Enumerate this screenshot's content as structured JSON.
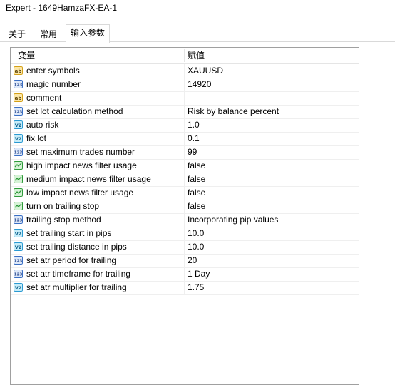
{
  "window": {
    "title": "Expert - 1649HamzaFX-EA-1"
  },
  "tabs": [
    {
      "label": "关于"
    },
    {
      "label": "常用"
    },
    {
      "label": "输入参数",
      "active": true
    }
  ],
  "table": {
    "headers": {
      "name": "变量",
      "value": "赋值"
    },
    "rows": [
      {
        "type": "ab",
        "name": "enter symbols",
        "value": "XAUUSD"
      },
      {
        "type": "123",
        "name": "magic number",
        "value": "14920"
      },
      {
        "type": "ab",
        "name": "comment",
        "value": ""
      },
      {
        "type": "123",
        "name": "set lot calculation method",
        "value": "Risk by balance percent"
      },
      {
        "type": "Va",
        "name": "auto risk",
        "value": "1.0"
      },
      {
        "type": "Va",
        "name": "fix lot",
        "value": "0.1"
      },
      {
        "type": "123",
        "name": "set maximum trades number",
        "value": "99"
      },
      {
        "type": "bool",
        "name": "high impact news filter usage",
        "value": "false"
      },
      {
        "type": "bool",
        "name": "medium impact news filter usage",
        "value": "false"
      },
      {
        "type": "bool",
        "name": "low impact news filter usage",
        "value": "false"
      },
      {
        "type": "bool",
        "name": "turn on trailing stop",
        "value": "false"
      },
      {
        "type": "123",
        "name": "trailing stop method",
        "value": "Incorporating pip values"
      },
      {
        "type": "Va",
        "name": "set trailing start in pips",
        "value": "10.0"
      },
      {
        "type": "Va",
        "name": "set trailing distance in pips",
        "value": "10.0"
      },
      {
        "type": "123",
        "name": "set atr period for trailing",
        "value": "20"
      },
      {
        "type": "123",
        "name": "set atr timeframe for trailing",
        "value": "1 Day"
      },
      {
        "type": "Va",
        "name": "set atr multiplier for trailing",
        "value": "1.75"
      }
    ]
  },
  "icon_names": {
    "ab": "string-type-icon",
    "123": "integer-type-icon",
    "Va": "double-type-icon",
    "bool": "bool-type-icon"
  },
  "colors": {
    "ab_bg": "#fce7a8",
    "ab_border": "#d4a017",
    "int_bg": "#dde8f8",
    "int_border": "#3a6fc4",
    "dbl_bg": "#c6ecf8",
    "dbl_border": "#2a9ad2",
    "bool_bg": "#d6f2d6",
    "bool_border": "#2e9b3a"
  }
}
